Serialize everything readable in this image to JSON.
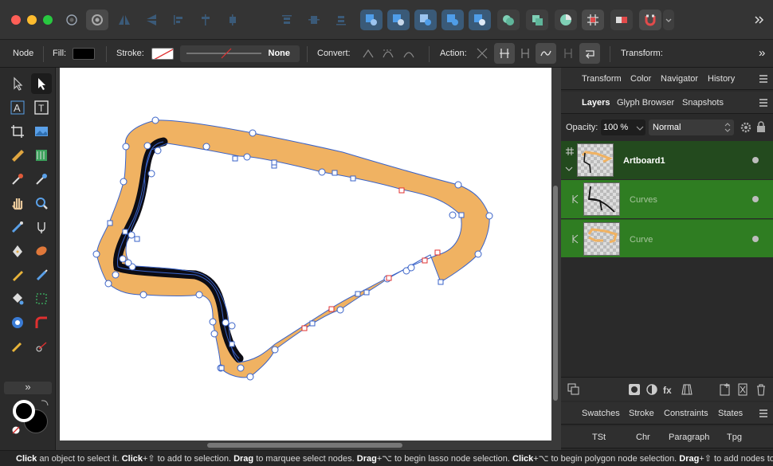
{
  "toolbar": {
    "icons": [
      "settings-icon",
      "persona-icon",
      "flip-h-icon",
      "flip-v-icon",
      "align-icon",
      "distribute-icon",
      "boolean-add-icon",
      "boolean-subtract-icon",
      "boolean-intersect-icon",
      "boolean-xor-icon",
      "boolean-divide-icon",
      "merge-icon",
      "combine-icon",
      "pie-icon",
      "grid-icon",
      "mask-icon",
      "snapping-icon"
    ]
  },
  "context": {
    "mode": "Node",
    "fill_label": "Fill:",
    "stroke_label": "Stroke:",
    "stroke_value": "None",
    "convert_label": "Convert:",
    "action_label": "Action:",
    "transform_label": "Transform:",
    "more": "»"
  },
  "panels": {
    "top_tabs": [
      "Transform",
      "Color",
      "Navigator",
      "History"
    ],
    "layer_tabs": [
      "Layers",
      "Glyph Browser",
      "Snapshots"
    ],
    "opacity_label": "Opacity:",
    "opacity_value": "100 %",
    "blend_mode": "Normal",
    "bottom_tabs": [
      "Swatches",
      "Stroke",
      "Constraints",
      "States"
    ],
    "text_tabs": [
      "TSt",
      "Chr",
      "Paragraph",
      "Tpg"
    ]
  },
  "layers": [
    {
      "name": "Artboard1",
      "indent": 0
    },
    {
      "name": "Curves",
      "indent": 1
    },
    {
      "name": "Curve",
      "indent": 1
    }
  ],
  "colors": {
    "accent_blue": "#3a7bd5",
    "layer_green": "#2f7d22",
    "artboard_green": "#234a1e",
    "shape_orange": "#f0b262",
    "path_blue": "#3a63c8"
  },
  "status": {
    "segments": [
      {
        "b": "Click",
        "t": " an object to select it. "
      },
      {
        "b": "Click",
        "t": "+⇧ to add to selection. "
      },
      {
        "b": "Drag",
        "t": " to marquee select nodes. "
      },
      {
        "b": "Drag",
        "t": "+⌥ to begin lasso node selection. "
      },
      {
        "b": "Click",
        "t": "+⌥ to begin polygon node selection. "
      },
      {
        "b": "Drag",
        "t": "+⇧ to add nodes to"
      }
    ]
  }
}
